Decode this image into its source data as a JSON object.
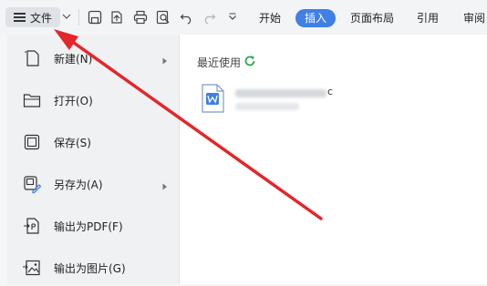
{
  "toolbar": {
    "file_label": "文件",
    "tabs": [
      {
        "label": "开始"
      },
      {
        "label": "插入"
      },
      {
        "label": "页面布局"
      },
      {
        "label": "引用"
      },
      {
        "label": "审阅"
      }
    ],
    "active_tab": "插入"
  },
  "file_menu": {
    "items": [
      {
        "label": "新建(N)",
        "icon": "new-file-icon",
        "has_submenu": true
      },
      {
        "label": "打开(O)",
        "icon": "folder-open-icon",
        "has_submenu": false
      },
      {
        "label": "保存(S)",
        "icon": "save-icon",
        "has_submenu": false
      },
      {
        "label": "另存为(A)",
        "icon": "save-as-icon",
        "has_submenu": true
      },
      {
        "label": "输出为PDF(F)",
        "icon": "export-pdf-icon",
        "has_submenu": false
      },
      {
        "label": "输出为图片(G)",
        "icon": "export-image-icon",
        "has_submenu": false
      }
    ]
  },
  "recent": {
    "title": "最近使用",
    "file_name_tail": "c"
  },
  "colors": {
    "accent": "#3f7fe6",
    "annotation_red": "#e3262b",
    "refresh_green": "#2fa84f"
  }
}
